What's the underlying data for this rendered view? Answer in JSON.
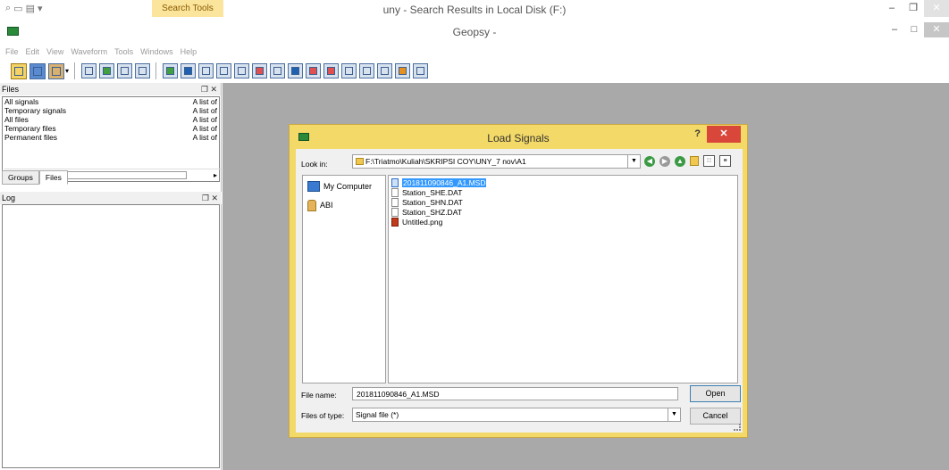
{
  "explorer": {
    "search_tools": "Search Tools",
    "title": "uny - Search Results in Local Disk (F:)"
  },
  "geopsy": {
    "title": "Geopsy -",
    "menu": [
      "File",
      "Edit",
      "View",
      "Waveform",
      "Tools",
      "Windows",
      "Help"
    ]
  },
  "files_panel": {
    "title": "Files",
    "rows": [
      {
        "name": "All signals",
        "desc": "A list of"
      },
      {
        "name": "Temporary signals",
        "desc": "A list of"
      },
      {
        "name": "All files",
        "desc": "A list of"
      },
      {
        "name": "Temporary files",
        "desc": "A list of"
      },
      {
        "name": "Permanent files",
        "desc": "A list of"
      }
    ],
    "tabs": [
      "Groups",
      "Files"
    ]
  },
  "log_panel": {
    "title": "Log"
  },
  "dialog": {
    "title": "Load Signals",
    "help": "?",
    "look_in_label": "Look in:",
    "look_in_path": "F:\\Triatmo\\Kuliah\\SKRIPSI COY\\UNY_7 nov\\A1",
    "sidebar": [
      "My Computer",
      "ABI"
    ],
    "files": [
      {
        "name": "201811090846_A1.MSD",
        "selected": true,
        "type": "msd"
      },
      {
        "name": "Station_SHE.DAT",
        "selected": false,
        "type": "dat"
      },
      {
        "name": "Station_SHN.DAT",
        "selected": false,
        "type": "dat"
      },
      {
        "name": "Station_SHZ.DAT",
        "selected": false,
        "type": "dat"
      },
      {
        "name": "Untitled.png",
        "selected": false,
        "type": "png"
      }
    ],
    "file_name_label": "File name:",
    "file_name_value": "201811090846_A1.MSD",
    "file_type_label": "Files of type:",
    "file_type_value": "Signal file (*)",
    "open_label": "Open",
    "cancel_label": "Cancel"
  }
}
